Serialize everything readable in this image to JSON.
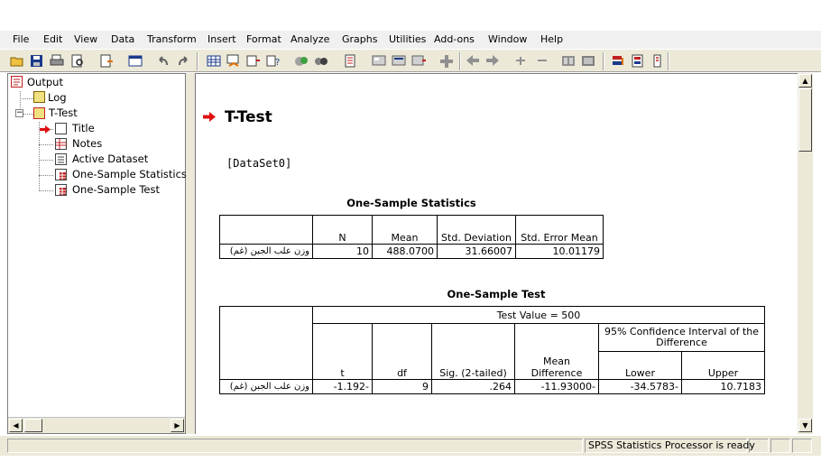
{
  "menu": [
    "File",
    "Edit",
    "View",
    "Data",
    "Transform",
    "Insert",
    "Format",
    "Analyze",
    "Graphs",
    "Utilities",
    "Add-ons",
    "Window",
    "Help"
  ],
  "outline": {
    "root": "Output",
    "log": "Log",
    "ttest": "T-Test",
    "children": [
      "Title",
      "Notes",
      "Active Dataset",
      "One-Sample Statistics",
      "One-Sample Test"
    ]
  },
  "content": {
    "heading": "T-Test",
    "dataset": "[DataSet0]",
    "stats_table": {
      "title": "One-Sample Statistics",
      "headers": [
        "N",
        "Mean",
        "Std. Deviation",
        "Std. Error Mean"
      ],
      "row": {
        "label": "وزن علب الجبن (غم)",
        "values": [
          "10",
          "488.0700",
          "31.66007",
          "10.01179"
        ]
      }
    },
    "test_table": {
      "title": "One-Sample Test",
      "test_value": "Test Value = 500",
      "ci_header": "95% Confidence Interval of the Difference",
      "headers": [
        "t",
        "df",
        "Sig. (2-tailed)",
        "Mean Difference",
        "Lower",
        "Upper"
      ],
      "row": {
        "label": "وزن علب الجبن (غم)",
        "values": [
          "-1.192-",
          "9",
          ".264",
          "-11.93000-",
          "-34.5783-",
          "10.7183"
        ]
      }
    }
  },
  "status": {
    "processor": "SPSS Statistics  Processor is ready"
  },
  "colors": {
    "arrow": "#e01010",
    "chrome": "#ece9d8"
  }
}
